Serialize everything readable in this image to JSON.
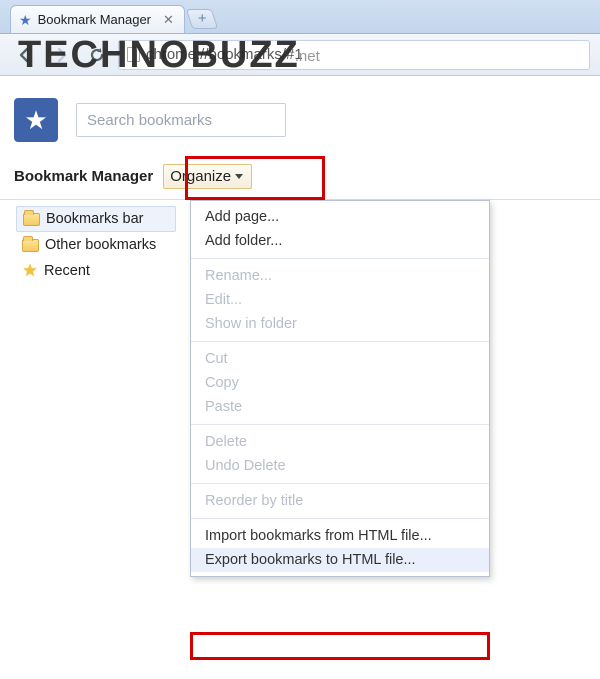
{
  "tab": {
    "title": "Bookmark Manager"
  },
  "nav": {
    "url": "chrome://bookmarks/#1"
  },
  "page": {
    "search_placeholder": "Search bookmarks",
    "header_title": "Bookmark Manager",
    "organize_label": "Organize"
  },
  "sidebar": {
    "items": [
      {
        "label": "Bookmarks bar",
        "icon": "folder",
        "selected": true
      },
      {
        "label": "Other bookmarks",
        "icon": "folder",
        "selected": false
      },
      {
        "label": "Recent",
        "icon": "star",
        "selected": false
      }
    ]
  },
  "menu": {
    "items": [
      {
        "label": "Add page...",
        "enabled": true
      },
      {
        "label": "Add folder...",
        "enabled": true
      },
      {
        "sep": true
      },
      {
        "label": "Rename...",
        "enabled": false
      },
      {
        "label": "Edit...",
        "enabled": false
      },
      {
        "label": "Show in folder",
        "enabled": false
      },
      {
        "sep": true
      },
      {
        "label": "Cut",
        "enabled": false
      },
      {
        "label": "Copy",
        "enabled": false
      },
      {
        "label": "Paste",
        "enabled": false
      },
      {
        "sep": true
      },
      {
        "label": "Delete",
        "enabled": false
      },
      {
        "label": "Undo Delete",
        "enabled": false
      },
      {
        "sep": true
      },
      {
        "label": "Reorder by title",
        "enabled": false
      },
      {
        "sep": true
      },
      {
        "label": "Import bookmarks from HTML file...",
        "enabled": true
      },
      {
        "label": "Export bookmarks to HTML file...",
        "enabled": true,
        "hover": true
      }
    ]
  },
  "watermark": {
    "main": "TECHNOBUZZ",
    "suffix": ".net"
  }
}
